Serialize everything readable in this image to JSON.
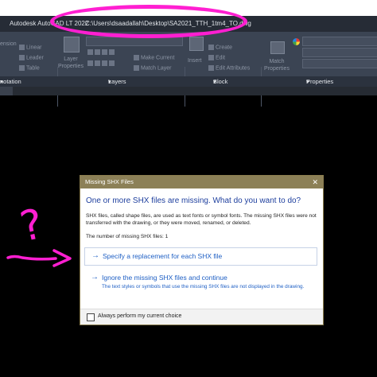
{
  "window": {
    "app_title": "Autodesk AutoCAD LT 2022",
    "file_path": "C:\\Users\\dsaadallah\\Desktop\\SA2021_TTH_1tm4_TO.dwg"
  },
  "ribbon": {
    "annotation_tools": [
      "Linear",
      "Leader",
      "Table"
    ],
    "side_label": "ension",
    "layer_properties_label": "Layer Properties",
    "layer_tools": [
      "Make Current",
      "Match Layer"
    ],
    "insert_label": "Insert",
    "block_tools": [
      "Create",
      "Edit",
      "Edit Attributes"
    ],
    "match_properties_label": "Match Properties"
  },
  "panels": {
    "annotation": "notation",
    "layers": "Layers",
    "block": "Block",
    "properties": "Properties"
  },
  "dialog": {
    "title": "Missing SHX Files",
    "question": "One or more SHX files are missing. What do you want to do?",
    "description": "SHX files, called shape files, are used as text fonts or symbol fonts. The missing SHX files were not transferred with the drawing, or they were moved, renamed, or deleted.",
    "missing_count_text": "The number of missing SHX files: 1",
    "option_specify": "Specify a replacement for each SHX file",
    "option_ignore": "Ignore the missing SHX files and continue",
    "option_ignore_sub": "The text styles or symbols that use the missing SHX files are not displayed in the drawing.",
    "checkbox_label": "Always perform my current choice",
    "close_glyph": "✕"
  },
  "annotations": {
    "question_mark": "?",
    "ink_color": "#ff1fd1"
  },
  "colors": {
    "titlebar": "#262c36",
    "ribbon": "#3b4453",
    "dialog_title": "#8c8057",
    "link_blue": "#1e5fc4",
    "heading_blue": "#1e3f9e"
  }
}
